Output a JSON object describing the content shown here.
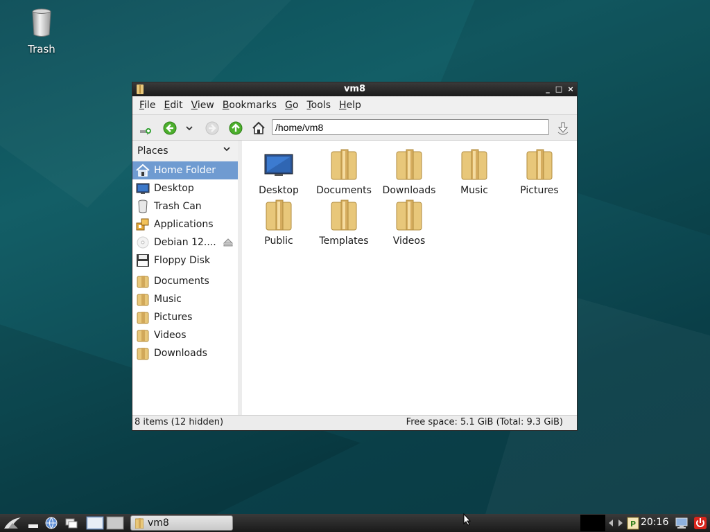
{
  "desktop": {
    "icons": [
      {
        "label": "Trash",
        "icon": "trash-icon"
      }
    ]
  },
  "window": {
    "title": "vm8",
    "controls": {
      "minimize": "_",
      "maximize": "□",
      "close": "×"
    },
    "menu": [
      "File",
      "Edit",
      "View",
      "Bookmarks",
      "Go",
      "Tools",
      "Help"
    ],
    "menu_mnemonics": [
      "F",
      "E",
      "V",
      "B",
      "G",
      "T",
      "H"
    ],
    "path": "/home/vm8",
    "sidebar": {
      "header": "Places",
      "places": [
        {
          "label": "Home Folder",
          "icon": "home-icon",
          "selected": true
        },
        {
          "label": "Desktop",
          "icon": "desktop-icon"
        },
        {
          "label": "Trash Can",
          "icon": "trash-icon"
        },
        {
          "label": "Applications",
          "icon": "applications-icon"
        },
        {
          "label": "Debian 12....",
          "icon": "disc-icon"
        },
        {
          "label": "Floppy Disk",
          "icon": "floppy-icon"
        }
      ],
      "bookmarks": [
        {
          "label": "Documents",
          "icon": "folder-icon"
        },
        {
          "label": "Music",
          "icon": "folder-icon"
        },
        {
          "label": "Pictures",
          "icon": "folder-icon"
        },
        {
          "label": "Videos",
          "icon": "folder-icon"
        },
        {
          "label": "Downloads",
          "icon": "folder-icon"
        }
      ]
    },
    "files": [
      {
        "name": "Desktop",
        "icon": "desktop-folder-icon"
      },
      {
        "name": "Documents",
        "icon": "folder-icon"
      },
      {
        "name": "Downloads",
        "icon": "folder-icon"
      },
      {
        "name": "Music",
        "icon": "folder-icon"
      },
      {
        "name": "Pictures",
        "icon": "folder-icon"
      },
      {
        "name": "Public",
        "icon": "folder-icon"
      },
      {
        "name": "Templates",
        "icon": "folder-icon"
      },
      {
        "name": "Videos",
        "icon": "folder-icon"
      }
    ],
    "status": {
      "items": "8 items (12 hidden)",
      "free_space": "Free space: 5.1 GiB (Total: 9.3 GiB)"
    }
  },
  "taskbar": {
    "task_label": "vm8",
    "clock": "20:16"
  },
  "colors": {
    "selection": "#6f9bd1",
    "folder": "#e8c77a",
    "desktop_bg": "#0f5059",
    "nav_green": "#4caf2c",
    "power_red": "#d9261c"
  }
}
